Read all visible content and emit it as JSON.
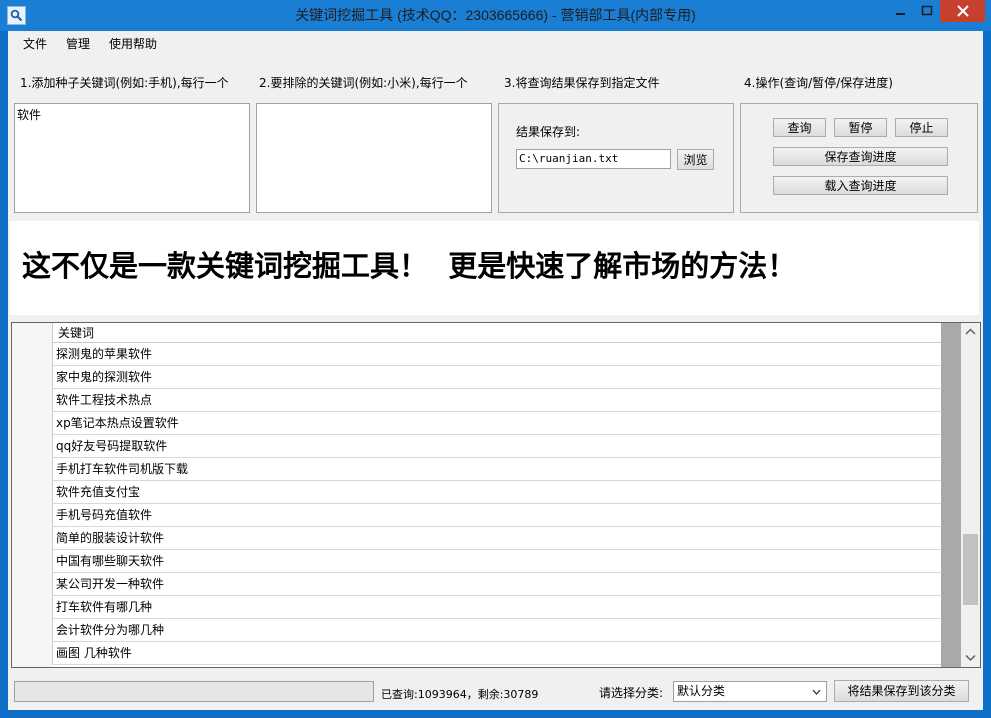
{
  "window": {
    "title": "关键词挖掘工具 (技术QQ：2303665666) - 营销部工具(内部专用)"
  },
  "menu": [
    "文件",
    "管理",
    "使用帮助"
  ],
  "steps": [
    "1.添加种子关键词(例如:手机),每行一个",
    "2.要排除的关键词(例如:小米),每行一个",
    "3.将查询结果保存到指定文件",
    "4.操作(查询/暂停/保存进度)"
  ],
  "seed_keywords": {
    "value": "软件"
  },
  "exclude_keywords": {
    "value": ""
  },
  "save_panel": {
    "label": "结果保存到:",
    "path": "C:\\ruanjian.txt",
    "browse": "浏览"
  },
  "actions": {
    "query": "查询",
    "pause": "暂停",
    "stop": "停止",
    "save_progress": "保存查询进度",
    "load_progress": "载入查询进度"
  },
  "banner": "这不仅是一款关键词挖掘工具！  更是快速了解市场的方法！",
  "table": {
    "header": "关键词",
    "rows": [
      "探测鬼的苹果软件",
      "家中鬼的探测软件",
      "软件工程技术热点",
      "xp笔记本热点设置软件",
      "qq好友号码提取软件",
      "手机打车软件司机版下载",
      "软件充值支付宝",
      "手机号码充值软件",
      "简单的服装设计软件",
      "中国有哪些聊天软件",
      "某公司开发一种软件",
      "打车软件有哪几种",
      "会计软件分为哪几种",
      "画图 几种软件"
    ]
  },
  "status": {
    "progress_text": "已查询:1093964，剩余:30789",
    "category_label": "请选择分类:",
    "category_value": "默认分类",
    "save_to_category": "将结果保存到该分类"
  },
  "colors": {
    "titlebar": "#1a7fd4",
    "close_button": "#c7402f"
  }
}
